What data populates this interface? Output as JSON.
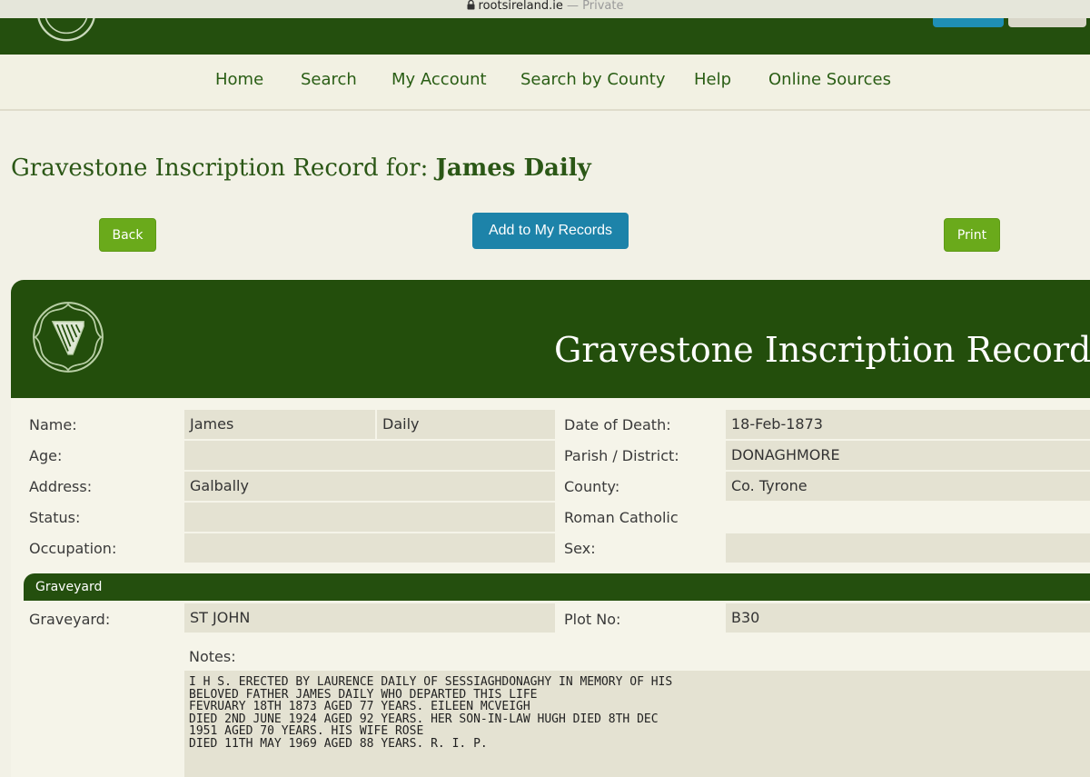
{
  "browser": {
    "domain": "rootsireland.ie",
    "privacy": "— Private"
  },
  "nav": {
    "items": [
      "Home",
      "Search",
      "My Account",
      "Search by County",
      "Help",
      "Online Sources"
    ]
  },
  "page": {
    "title_prefix": "Gravestone Inscription Record for:",
    "title_name": "James Daily"
  },
  "buttons": {
    "back": "Back",
    "add": "Add to My Records",
    "print": "Print"
  },
  "record": {
    "header_title": "Gravestone Inscription Record",
    "labels": {
      "name": "Name:",
      "age": "Age:",
      "address": "Address:",
      "status": "Status:",
      "occupation": "Occupation:",
      "date_of_death": "Date of Death:",
      "parish": "Parish / District:",
      "county": "County:",
      "religion": "Roman Catholic",
      "sex": "Sex:"
    },
    "values": {
      "first_name": "James",
      "surname": "Daily",
      "age": "",
      "address": "Galbally",
      "status": "",
      "occupation": "",
      "date_of_death": "18-Feb-1873",
      "parish": "DONAGHMORE",
      "county": "Co. Tyrone",
      "religion_value": "",
      "sex": ""
    },
    "graveyard_section": {
      "title": "Graveyard",
      "graveyard_label": "Graveyard:",
      "graveyard_value": "ST JOHN",
      "plot_label": "Plot No:",
      "plot_value": "B30",
      "notes_label": "Notes:",
      "notes": "I H S. ERECTED BY LAURENCE DAILY OF SESSIAGHDONAGHY IN MEMORY OF HIS\nBELOVED FATHER JAMES DAILY WHO DEPARTED THIS LIFE\nFEVRUARY 18TH 1873 AGED 77 YEARS. EILEEN MCVEIGH\nDIED 2ND JUNE 1924 AGED 92 YEARS. HER SON-IN-LAW HUGH DIED 8TH DEC\n1951 AGED 70 YEARS. HIS WIFE ROSE\nDIED 11TH MAY 1969 AGED 88 YEARS. R. I. P."
    }
  },
  "colors": {
    "dark_green": "#244f0e",
    "nav_green": "#295d14",
    "button_green": "#6aaa1b",
    "button_blue": "#1d83a9",
    "cell_bg": "#e4e2d2"
  }
}
